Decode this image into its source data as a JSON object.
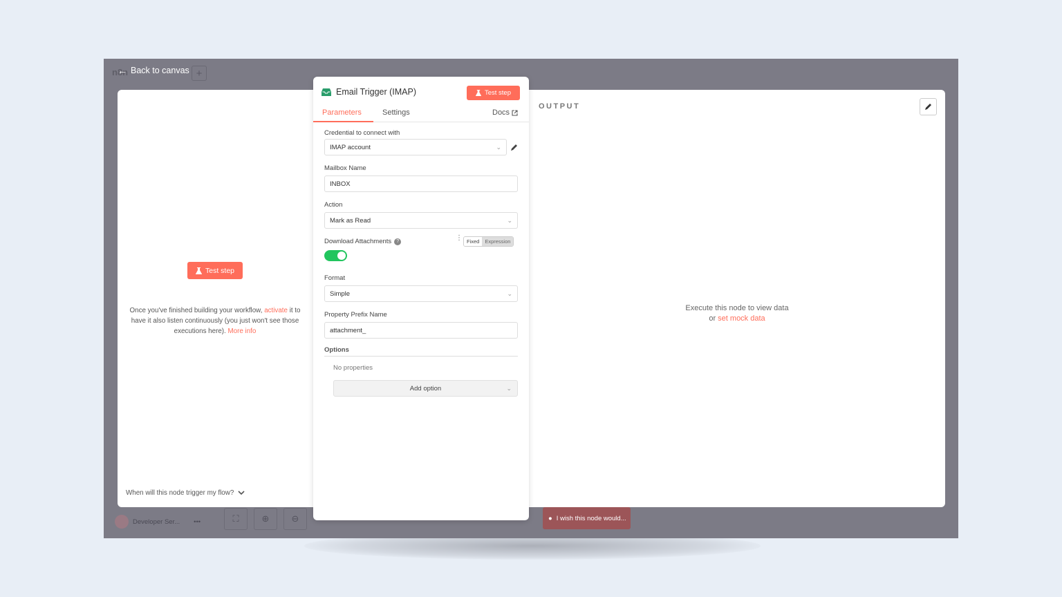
{
  "background": {
    "bg_color": "#e8eef6"
  },
  "backdrop": {
    "logo_text": "n8n",
    "back_label": "Back to canvas",
    "plus_label": "+",
    "developer_label": "Developer Ser...",
    "more_label": "•••",
    "wish_label": "I wish this node would..."
  },
  "node": {
    "title": "Email Trigger (IMAP)",
    "test_step_label": "Test step",
    "tabs": {
      "parameters": "Parameters",
      "settings": "Settings",
      "docs": "Docs"
    },
    "fields": {
      "credential_label": "Credential to connect with",
      "credential_value": "IMAP account",
      "mailbox_label": "Mailbox Name",
      "mailbox_value": "INBOX",
      "action_label": "Action",
      "action_value": "Mark as Read",
      "download_label": "Download Attachments",
      "download_enabled": true,
      "fixed_label": "Fixed",
      "expression_label": "Expression",
      "format_label": "Format",
      "format_value": "Simple",
      "prefix_label": "Property Prefix Name",
      "prefix_value": "attachment_",
      "options_label": "Options",
      "no_properties": "No properties",
      "add_option": "Add option"
    }
  },
  "input_panel": {
    "test_step_label": "Test step",
    "info_pre": "Once you've finished building your workflow,",
    "info_link": "activate",
    "info_mid": "it to have it also listen continuously (you just won't see those executions here).",
    "more_info": "More info",
    "flow_question": "When will this node trigger my flow?"
  },
  "output_panel": {
    "label": "OUTPUT",
    "empty_line1": "Execute this node to view data",
    "empty_or": "or",
    "mock_link": "set mock data"
  },
  "colors": {
    "accent": "#ff6d5a",
    "toggle_on": "#22c55e",
    "overlay": "#7c7b86"
  },
  "icons": [
    "arrow-left-icon",
    "beaker-icon",
    "inbox-icon",
    "external-link-icon",
    "pencil-icon",
    "chevron-down-icon",
    "help-icon",
    "kebab-icon",
    "lightbulb-icon",
    "fit-view-icon",
    "zoom-in-icon",
    "zoom-out-icon"
  ]
}
